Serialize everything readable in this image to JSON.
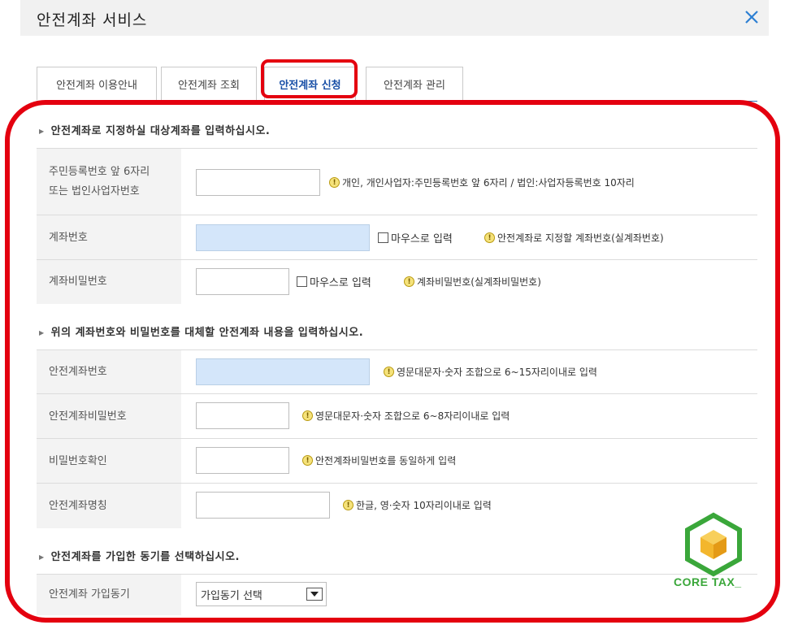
{
  "window": {
    "title": "안전계좌 서비스"
  },
  "tabs": [
    {
      "label": "안전계좌 이용안내"
    },
    {
      "label": "안전계좌 조회"
    },
    {
      "label": "안전계좌 신청",
      "active": true
    },
    {
      "label": "안전계좌 관리"
    }
  ],
  "sections": {
    "target": {
      "title": "안전계좌로 지정하실 대상계좌를 입력하십시오."
    },
    "replace": {
      "title": "위의 계좌번호와 비밀번호를 대체할 안전계좌 내용을 입력하십시오."
    },
    "motive": {
      "title": "안전계좌를 가입한 동기를 선택하십시오."
    }
  },
  "fields": {
    "id_number": {
      "label_line1": "주민등록번호 앞 6자리",
      "label_line2": "또는 법인사업자번호",
      "value": "",
      "hint": "개인, 개인사업자:주민등록번호 앞 6자리 / 법인:사업자등록번호 10자리"
    },
    "account_number": {
      "label": "계좌번호",
      "value": "",
      "mouse_input": "마우스로 입력",
      "hint": "안전계좌로 지정할 계좌번호(실계좌번호)"
    },
    "account_password": {
      "label": "계좌비밀번호",
      "value": "",
      "mouse_input": "마우스로 입력",
      "hint": "계좌비밀번호(실계좌비밀번호)"
    },
    "safe_account_number": {
      "label": "안전계좌번호",
      "value": "",
      "hint": "영문대문자·숫자 조합으로 6~15자리이내로 입력"
    },
    "safe_account_password": {
      "label": "안전계좌비밀번호",
      "value": "",
      "hint": "영문대문자·숫자 조합으로 6~8자리이내로 입력"
    },
    "password_confirm": {
      "label": "비밀번호확인",
      "value": "",
      "hint": "안전계좌비밀번호를 동일하게 입력"
    },
    "safe_account_name": {
      "label": "안전계좌명칭",
      "value": "",
      "hint": "한글, 영·숫자 10자리이내로 입력"
    },
    "join_motive": {
      "label": "안전계좌 가입동기",
      "selected": "가입동기 선택"
    }
  },
  "watermark": {
    "text": "CORE TAX_"
  },
  "icons": {
    "close": "close-icon",
    "info": "info-icon",
    "dropdown": "chevron-down-icon",
    "section_arrow": "caret-right-icon",
    "logo": "cube-hexagon-logo"
  },
  "colors": {
    "highlight_red": "#e4000f",
    "active_tab_text": "#174ea6",
    "tab_underline": "#2e6fb7",
    "close_icon": "#2d7fd3",
    "logo_green": "#3aa73a",
    "logo_yellow": "#f3b62d",
    "highlighted_input": "#d4e6fa"
  }
}
